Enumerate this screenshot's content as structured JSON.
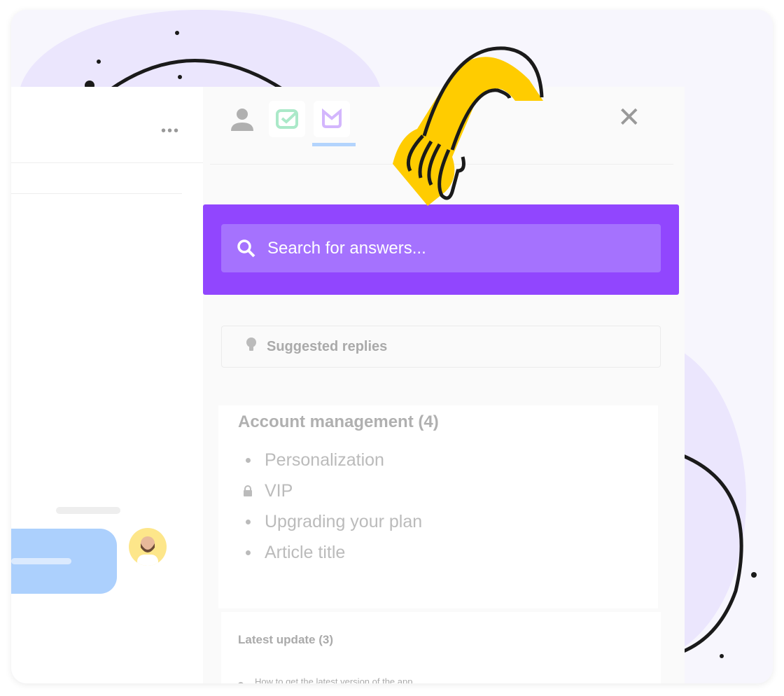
{
  "toolbar": {
    "more_icon": "ellipsis-icon",
    "tabs": [
      {
        "icon": "user-icon"
      },
      {
        "icon": "checkbox-icon",
        "color": "#abe9c9"
      },
      {
        "icon": "knowledge-book-icon",
        "color": "#d3b6fd",
        "active": true
      }
    ],
    "close_icon": "close-icon"
  },
  "search": {
    "placeholder": "Search for answers...",
    "band_color": "#9146fe"
  },
  "suggested": {
    "label": "Suggested replies",
    "icon": "lightbulb-icon"
  },
  "category": {
    "title": "Account management (4)",
    "items": [
      {
        "label": "Personalization",
        "icon": "bullet"
      },
      {
        "label": "VIP",
        "icon": "lock-icon"
      },
      {
        "label": "Upgrading your plan",
        "icon": "bullet"
      },
      {
        "label": "Article title",
        "icon": "bullet"
      }
    ]
  },
  "latest": {
    "title": "Latest update (3)",
    "items": [
      {
        "label": "How to get the latest version of the app."
      }
    ]
  }
}
